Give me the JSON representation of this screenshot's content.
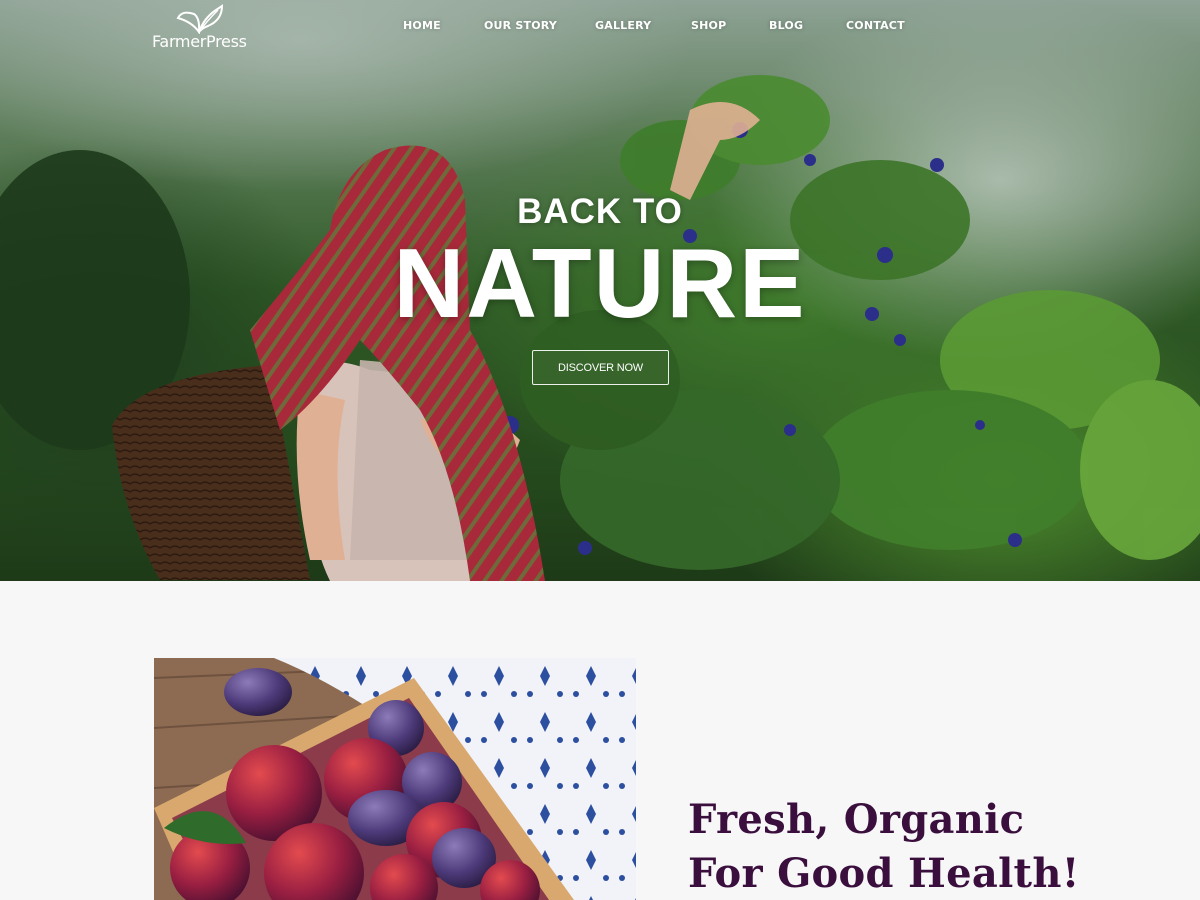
{
  "brand": {
    "name": "FarmerPress"
  },
  "nav": {
    "items": [
      {
        "label": "HOME"
      },
      {
        "label": "OUR STORY"
      },
      {
        "label": "GALLERY"
      },
      {
        "label": "SHOP"
      },
      {
        "label": "BLOG"
      },
      {
        "label": "CONTACT"
      }
    ]
  },
  "hero": {
    "kicker": "BACK TO",
    "title": "NATURE",
    "cta_label": "DISCOVER NOW",
    "image": "woman-picking-butterfly-pea-flowers-with-basket"
  },
  "feature": {
    "image": "wooden-crate-of-plums-on-table",
    "headline_line1": "Fresh, Organic",
    "headline_line2": "For Good Health!"
  },
  "colors": {
    "headline": "#3a0f3d",
    "nav_text": "#ffffff",
    "section_bg": "#f7f7f8"
  }
}
